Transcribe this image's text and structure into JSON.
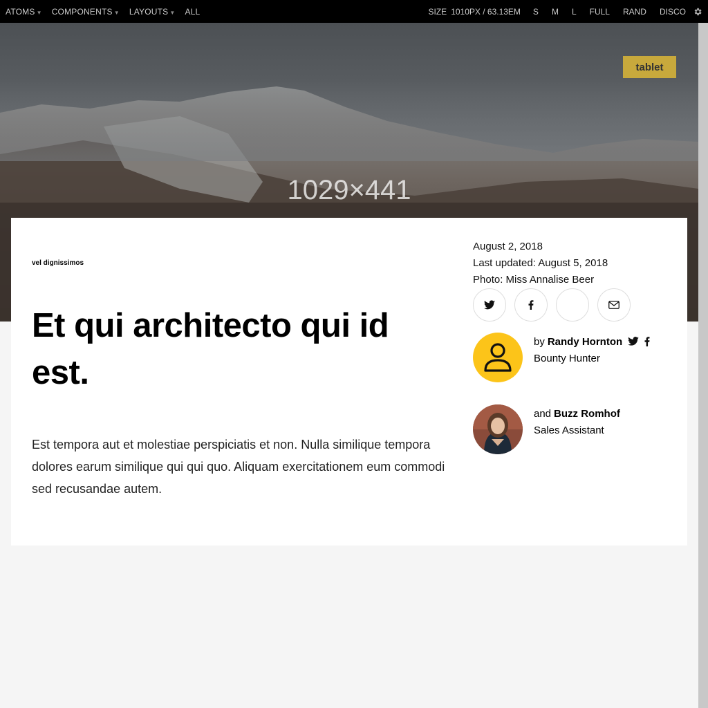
{
  "toolbar": {
    "nav": [
      {
        "label": "ATOMS",
        "has_caret": true
      },
      {
        "label": "COMPONENTS",
        "has_caret": true
      },
      {
        "label": "LAYOUTS",
        "has_caret": true
      },
      {
        "label": "ALL",
        "has_caret": false
      }
    ],
    "size_label": "SIZE",
    "size_value": "1010PX /  63.13EM",
    "size_buttons": [
      "S",
      "M",
      "L",
      "FULL",
      "RAND",
      "DISCO"
    ],
    "settings_icon": "gear-icon"
  },
  "hero": {
    "placeholder_text": "1029×441",
    "badge": "tablet"
  },
  "article": {
    "kicker": "vel dignissimos",
    "headline": "Et qui architecto qui id est.",
    "deck": "Est tempora aut et molestiae perspiciatis et non. Nulla similique tempora dolores earum similique qui qui quo. Aliquam exercitationem eum commodi sed recusandae autem.",
    "date": "August 2, 2018",
    "updated": "Last updated: August 5, 2018",
    "photo_credit": "Photo: Miss Annalise Beer",
    "share_icons": [
      "twitter-icon",
      "facebook-icon",
      "blank",
      "mail-icon"
    ],
    "authors": [
      {
        "prefix": "by",
        "name": "Randy Hornton",
        "role": "Bounty Hunter",
        "avatar": "user-placeholder-icon",
        "social": [
          "twitter-icon",
          "facebook-icon"
        ]
      },
      {
        "prefix": "and",
        "name": "Buzz Romhof",
        "role": "Sales Assistant",
        "avatar": "photo"
      }
    ]
  },
  "colors": {
    "toolbar_bg": "#000000",
    "badge_bg": "#c8a93c",
    "avatar_placeholder_bg": "#fcc419",
    "page_bg": "#f5f5f5"
  }
}
